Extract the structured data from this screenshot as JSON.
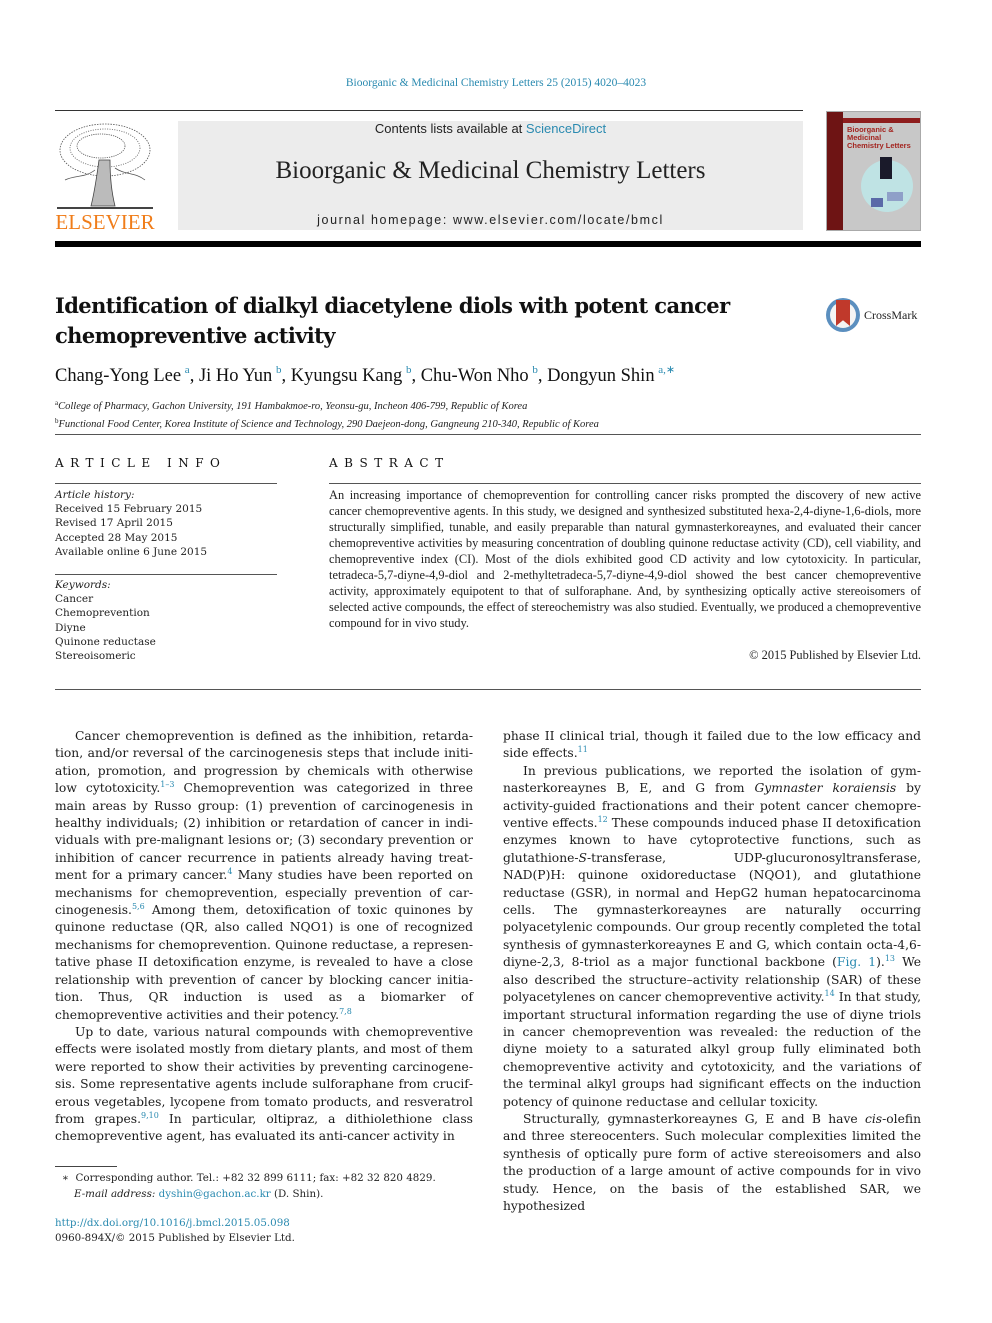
{
  "header": {
    "citation": "Bioorganic & Medicinal Chemistry Letters 25 (2015) 4020–4023",
    "contents_prefix": "Contents lists available at ",
    "contents_link": "ScienceDirect",
    "journal_title": "Bioorganic & Medicinal Chemistry Letters",
    "homepage": "journal homepage: www.elsevier.com/locate/bmcl",
    "publisher_logo_text": "ELSEVIER",
    "cover_title": "Bioorganic & Medicinal Chemistry Letters",
    "crossmark_label": "CrossMark"
  },
  "article": {
    "title": "Identification of dialkyl diacetylene diols with potent cancer chemopreventive activity",
    "authors": [
      {
        "name": "Chang-Yong Lee",
        "aff": "a"
      },
      {
        "name": "Ji Ho Yun",
        "aff": "b"
      },
      {
        "name": "Kyungsu Kang",
        "aff": "b"
      },
      {
        "name": "Chu-Won Nho",
        "aff": "b"
      },
      {
        "name": "Dongyun Shin",
        "aff": "a,∗"
      }
    ],
    "affiliations": [
      {
        "key": "a",
        "text": "College of Pharmacy, Gachon University, 191 Hambakmoe-ro, Yeonsu-gu, Incheon 406-799, Republic of Korea"
      },
      {
        "key": "b",
        "text": "Functional Food Center, Korea Institute of Science and Technology, 290 Daejeon-dong, Gangneung 210-340, Republic of Korea"
      }
    ]
  },
  "article_info": {
    "heading": "ARTICLE INFO",
    "history_label": "Article history:",
    "history": [
      "Received 15 February 2015",
      "Revised 17 April 2015",
      "Accepted 28 May 2015",
      "Available online 6 June 2015"
    ],
    "keywords_label": "Keywords:",
    "keywords": [
      "Cancer",
      "Chemoprevention",
      "Diyne",
      "Quinone reductase",
      "Stereoisomeric"
    ]
  },
  "abstract": {
    "heading": "ABSTRACT",
    "text": "An increasing importance of chemoprevention for controlling cancer risks prompted the discovery of new active cancer chemopreventive agents. In this study, we designed and synthesized substituted hexa-2,4-diyne-1,6-diols, more structurally simplified, tunable, and easily preparable than natural gymnasterkoreaynes, and evaluated their cancer chemopreventive activities by measuring concentration of doubling quinone reductase activity (CD), cell viability, and chemopreventive index (CI). Most of the diols exhibited good CD activity and low cytotoxicity. In particular, tetradeca-5,7-diyne-4,9-diol and 2-methyltetradeca-5,7-diyne-4,9-diol showed the best cancer chemopreventive activity, approximately equipotent to that of sulforaphane. And, by synthesizing optically active stereoisomers of selected active compounds, the effect of stereochemistry was also studied. Eventually, we produced a chemopreventive compound for in vivo study.",
    "copyright": "© 2015 Published by Elsevier Ltd."
  },
  "body": {
    "left": [
      {
        "segments": [
          {
            "t": "Cancer chemoprevention is defined as the inhibition, retarda­tion, and/or reversal of the carcinogenesis steps that include initi­ation, promotion, and progression by chemicals with otherwise low cytotoxicity."
          },
          {
            "ref": "1–3"
          },
          {
            "t": " Chemoprevention was categorized in three main areas by Russo group: (1) prevention of carcinogenesis in healthy individuals; (2) inhibition or retardation of cancer in indi­viduals with pre-malignant lesions or; (3) secondary prevention or inhibition of cancer recurrence in patients already having treat­ment for a primary cancer."
          },
          {
            "ref": "4"
          },
          {
            "t": " Many studies have been reported on mechanisms for chemoprevention, especially prevention of car­cinogenesis."
          },
          {
            "ref": "5,6"
          },
          {
            "t": " Among them, detoxification of toxic quinones by quinone reductase (QR, also called NQO1) is one of recognized mechanisms for chemoprevention. Quinone reductase, a represen­tative phase II detoxification enzyme, is revealed to have a close relationship with prevention of cancer by blocking cancer initia­tion. Thus, QR induction is used as a biomarker of chemopreventive activities and their potency."
          },
          {
            "ref": "7,8"
          }
        ]
      },
      {
        "segments": [
          {
            "t": "Up to date, various natural compounds with chemopreventive effects were isolated mostly from dietary plants, and most of them were reported to show their activities by preventing carcinogene­sis. Some representative agents include sulforaphane from crucif­erous vegetables, lycopene from tomato products, and resveratrol from grapes."
          },
          {
            "ref": "9,10"
          },
          {
            "t": " In particular, oltipraz, a dithiolethione class chemopreventive agent, has evaluated its anti-cancer activity in"
          }
        ]
      }
    ],
    "right": [
      {
        "noindent": true,
        "segments": [
          {
            "t": "phase II clinical trial, though it failed due to the low efficacy and side effects."
          },
          {
            "ref": "11"
          }
        ]
      },
      {
        "segments": [
          {
            "t": "In previous publications, we reported the isolation of gym­nasterkoreaynes B, E, and G from "
          },
          {
            "i": "Gymnaster koraiensis"
          },
          {
            "t": " by activity-guided fractionations and their potent cancer chemopre­ventive effects."
          },
          {
            "ref": "12"
          },
          {
            "t": " These compounds induced phase II detoxification enzymes known to have cytoprotective functions, such as glutathione-"
          },
          {
            "i": "S"
          },
          {
            "t": "-transferase, UDP-glucuronosyltransferase, NAD(P)H: quinone oxidoreductase (NQO1), and glutathione reductase (GSR), in normal and HepG2 human hepatocarcinoma cells. The gym­nasterkoreaynes are naturally occurring polyacetylenic com­pounds. Our group recently completed the total synthesis of gymnasterkoreaynes E and G, which contain octa-4,6-diyne-2,3, 8-triol as a major functional backbone ("
          },
          {
            "link": "Fig. 1"
          },
          {
            "t": ")."
          },
          {
            "ref": "13"
          },
          {
            "t": " We also described the structure–activity relationship (SAR) of these polyacetylenes on cancer chemopreventive activity."
          },
          {
            "ref": "14"
          },
          {
            "t": " In that study, important structural information regarding the use of diyne triols in cancer chemoprevention was revealed: the reduction of the diyne moiety to a saturated alkyl group fully eliminated both chemopreventive activity and cytotoxicity, and the variations of the terminal alkyl groups had significant effects on the induction potency of quinone reductase and cellular toxicity."
          }
        ]
      },
      {
        "segments": [
          {
            "t": "Structurally, gymnasterkoreaynes G, E and B have "
          },
          {
            "i": "cis"
          },
          {
            "t": "-olefin and three stereocenters. Such molecular complexities limited the syn­thesis of optically pure form of active stereoisomers and also the production of a large amount of active compounds for in vivo study. Hence, on the basis of the established SAR, we hypothesized"
          }
        ]
      }
    ]
  },
  "footnote": {
    "marker": "∗",
    "corresponding": "Corresponding author. Tel.: +82 32 899 6111; fax: +82 32 820 4829.",
    "email_label": "E-mail address:",
    "email": "dyshin@gachon.ac.kr",
    "email_suffix": " (D. Shin).",
    "doi": "http://dx.doi.org/10.1016/j.bmcl.2015.05.098",
    "issn": "0960-894X/© 2015 Published by Elsevier Ltd."
  }
}
